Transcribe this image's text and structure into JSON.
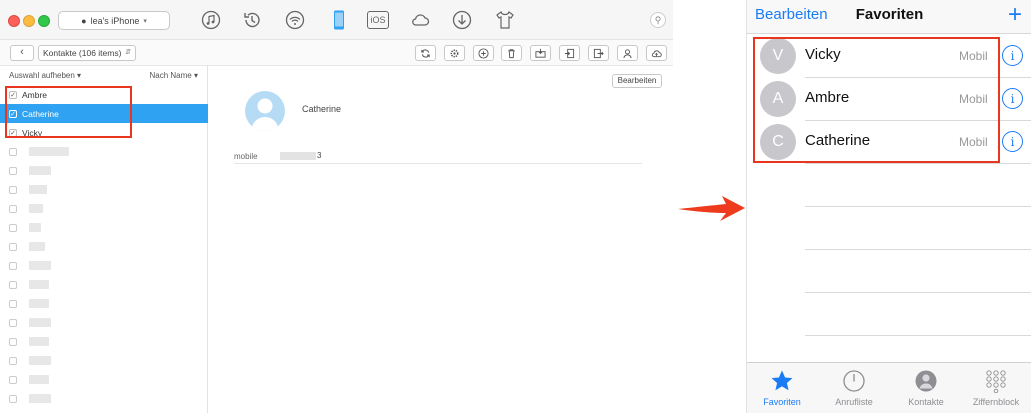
{
  "mac_app": {
    "device_name": "lea's iPhone",
    "category": "Kontakte (106 items)",
    "list_header": {
      "deselect_label": "Auswahl aufheben",
      "sort_label": "Nach Name"
    },
    "contacts": [
      {
        "name": "Ambre",
        "checked": true,
        "selected": false
      },
      {
        "name": "Catherine",
        "checked": true,
        "selected": true
      },
      {
        "name": "Vicky",
        "checked": true,
        "selected": false
      }
    ],
    "detail": {
      "edit_label": "Bearbeiten",
      "contact_name": "Catherine",
      "field_label": "mobile",
      "field_value_suffix": "3"
    },
    "toolbar_icons": [
      "music-icon",
      "history-icon",
      "wifi-icon",
      "iphone-icon",
      "ios-icon",
      "cloud-icon",
      "download-icon",
      "shirt-icon"
    ],
    "toolbar_ios_label": "iOS",
    "action_icons": [
      "refresh-icon",
      "settings-icon",
      "add-icon",
      "trash-icon",
      "to-device-icon",
      "import-icon",
      "export-icon",
      "contact-icon",
      "upload-cloud-icon"
    ]
  },
  "iphone": {
    "nav": {
      "edit_label": "Bearbeiten",
      "title": "Favoriten",
      "add_label": "+"
    },
    "favorites": [
      {
        "initial": "V",
        "name": "Vicky",
        "type": "Mobil"
      },
      {
        "initial": "A",
        "name": "Ambre",
        "type": "Mobil"
      },
      {
        "initial": "C",
        "name": "Catherine",
        "type": "Mobil"
      }
    ],
    "tabs": [
      {
        "label": "Favoriten",
        "icon": "star-icon",
        "active": true
      },
      {
        "label": "Anrufliste",
        "icon": "clock-icon",
        "active": false
      },
      {
        "label": "Kontakte",
        "icon": "person-icon",
        "active": false
      },
      {
        "label": "Ziffernblock",
        "icon": "keypad-icon",
        "active": false
      }
    ]
  },
  "colors": {
    "accent_ios": "#1a7cf5",
    "selection": "#2fa3f1",
    "highlight": "#e8361f"
  }
}
